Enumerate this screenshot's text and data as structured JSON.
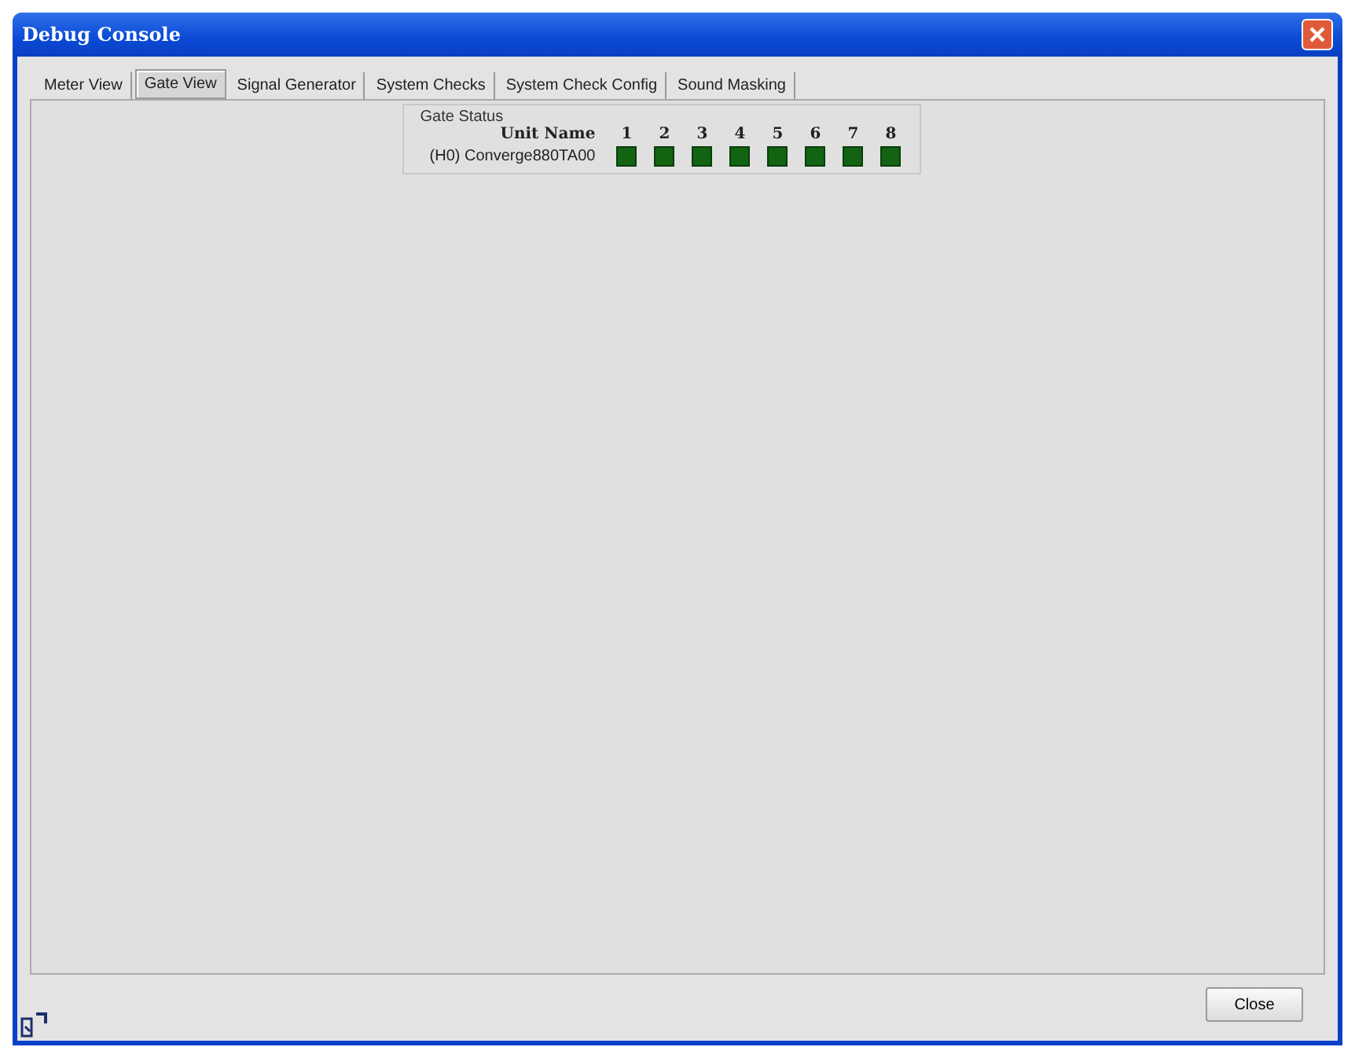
{
  "window": {
    "title": "Debug Console"
  },
  "tabs": [
    {
      "label": "Meter View",
      "selected": false
    },
    {
      "label": "Gate View",
      "selected": true
    },
    {
      "label": "Signal Generator",
      "selected": false
    },
    {
      "label": "System Checks",
      "selected": false
    },
    {
      "label": "System Check Config",
      "selected": false
    },
    {
      "label": "Sound Masking",
      "selected": false
    }
  ],
  "gate_status": {
    "title": "Gate Status",
    "unit_name_header": "Unit Name",
    "channels": [
      "1",
      "2",
      "3",
      "4",
      "5",
      "6",
      "7",
      "8"
    ],
    "rows": [
      {
        "unit": "(H0) Converge880TA00",
        "gates": [
          {
            "on": true
          },
          {
            "on": true
          },
          {
            "on": true
          },
          {
            "on": true
          },
          {
            "on": true
          },
          {
            "on": true
          },
          {
            "on": true
          },
          {
            "on": true
          }
        ]
      }
    ]
  },
  "buttons": [
    "Close"
  ]
}
